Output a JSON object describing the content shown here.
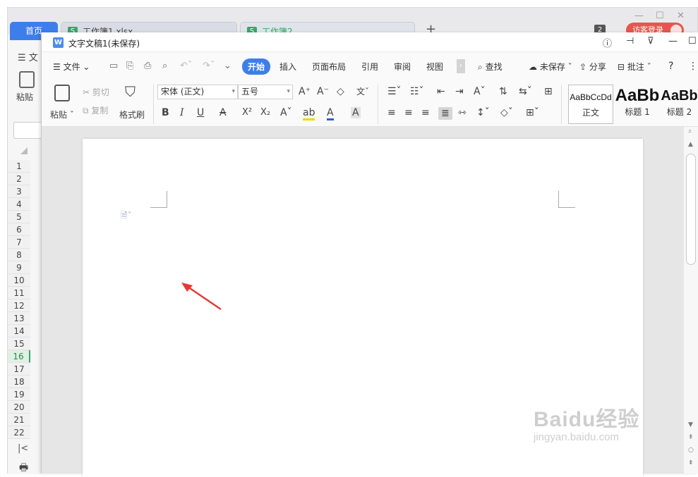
{
  "background_window": {
    "tabs": {
      "home": "首页",
      "tab1": "工作簿1.xlsx",
      "tab2": "工作簿2",
      "add": "+"
    },
    "guest_login": "访客登录",
    "badge": "2",
    "menu_fragment": "文",
    "paste_label": "粘贴",
    "row_numbers": [
      "1",
      "2",
      "3",
      "4",
      "5",
      "6",
      "7",
      "8",
      "9",
      "10",
      "11",
      "12",
      "13",
      "14",
      "15",
      "16",
      "17",
      "18",
      "19",
      "20",
      "21",
      "22"
    ],
    "selected_row": "16"
  },
  "window": {
    "title": "文字文稿1(未保存)",
    "icon_letter": "W"
  },
  "menu": {
    "file": "文件",
    "tabs": [
      "开始",
      "插入",
      "页面布局",
      "引用",
      "审阅",
      "视图"
    ],
    "active_tab": "开始",
    "search": "查找",
    "unsaved": "未保存",
    "share": "分享",
    "comment": "批注",
    "help": "?"
  },
  "ribbon": {
    "paste": "粘贴",
    "cut": "剪切",
    "copy": "复制",
    "format_painter": "格式刷",
    "font_name": "宋体 (正文)",
    "font_size": "五号",
    "bold": "B",
    "italic": "I",
    "underline": "U",
    "superscript": "X²",
    "subscript": "X₂",
    "styles": [
      {
        "preview": "AaBbCcDd",
        "label": "正文"
      },
      {
        "preview": "AaBb",
        "label": "标题 1"
      },
      {
        "preview": "AaBb",
        "label": "标题 2"
      }
    ]
  },
  "watermark": {
    "brand": "Baidu经验",
    "url": "jingyan.baidu.com"
  },
  "colors": {
    "accent": "#3d7eea",
    "arrow": "#e53935",
    "guest": "#e5574e",
    "sheet_green": "#2faa6b"
  }
}
